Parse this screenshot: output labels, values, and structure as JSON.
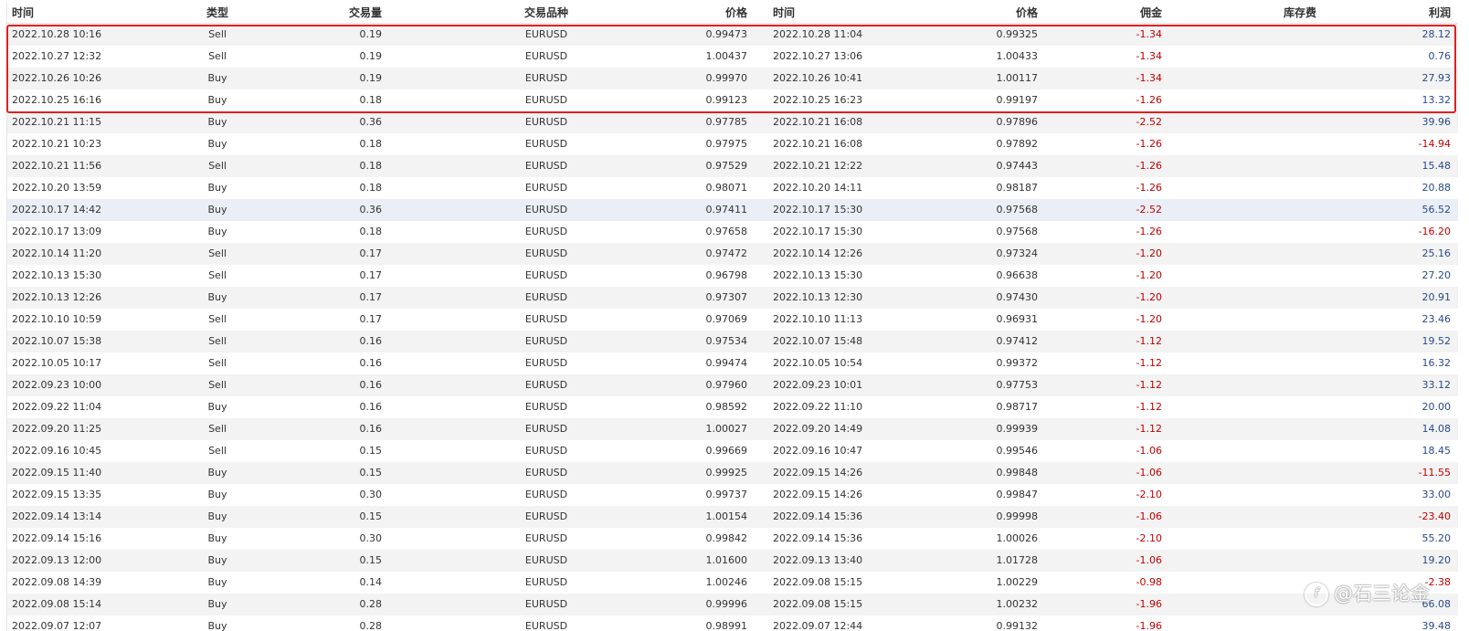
{
  "table": {
    "headers": {
      "open_time": "时间",
      "type": "类型",
      "volume": "交易量",
      "symbol": "交易品种",
      "open_price": "价格",
      "close_time": "时间",
      "close_price": "价格",
      "commission": "佣金",
      "swap": "库存费",
      "profit": "利润"
    },
    "rows": [
      {
        "open_time": "2022.10.28 10:16",
        "type": "Sell",
        "volume": "0.19",
        "symbol": "EURUSD",
        "open_price": "0.99473",
        "close_time": "2022.10.28 11:04",
        "close_price": "0.99325",
        "commission": "-1.34",
        "swap": "",
        "profit": "28.12"
      },
      {
        "open_time": "2022.10.27 12:32",
        "type": "Sell",
        "volume": "0.19",
        "symbol": "EURUSD",
        "open_price": "1.00437",
        "close_time": "2022.10.27 13:06",
        "close_price": "1.00433",
        "commission": "-1.34",
        "swap": "",
        "profit": "0.76"
      },
      {
        "open_time": "2022.10.26 10:26",
        "type": "Buy",
        "volume": "0.19",
        "symbol": "EURUSD",
        "open_price": "0.99970",
        "close_time": "2022.10.26 10:41",
        "close_price": "1.00117",
        "commission": "-1.34",
        "swap": "",
        "profit": "27.93"
      },
      {
        "open_time": "2022.10.25 16:16",
        "type": "Buy",
        "volume": "0.18",
        "symbol": "EURUSD",
        "open_price": "0.99123",
        "close_time": "2022.10.25 16:23",
        "close_price": "0.99197",
        "commission": "-1.26",
        "swap": "",
        "profit": "13.32"
      },
      {
        "open_time": "2022.10.21 11:15",
        "type": "Buy",
        "volume": "0.36",
        "symbol": "EURUSD",
        "open_price": "0.97785",
        "close_time": "2022.10.21 16:08",
        "close_price": "0.97896",
        "commission": "-2.52",
        "swap": "",
        "profit": "39.96"
      },
      {
        "open_time": "2022.10.21 10:23",
        "type": "Buy",
        "volume": "0.18",
        "symbol": "EURUSD",
        "open_price": "0.97975",
        "close_time": "2022.10.21 16:08",
        "close_price": "0.97892",
        "commission": "-1.26",
        "swap": "",
        "profit": "-14.94"
      },
      {
        "open_time": "2022.10.21 11:56",
        "type": "Sell",
        "volume": "0.18",
        "symbol": "EURUSD",
        "open_price": "0.97529",
        "close_time": "2022.10.21 12:22",
        "close_price": "0.97443",
        "commission": "-1.26",
        "swap": "",
        "profit": "15.48"
      },
      {
        "open_time": "2022.10.20 13:59",
        "type": "Buy",
        "volume": "0.18",
        "symbol": "EURUSD",
        "open_price": "0.98071",
        "close_time": "2022.10.20 14:11",
        "close_price": "0.98187",
        "commission": "-1.26",
        "swap": "",
        "profit": "20.88"
      },
      {
        "open_time": "2022.10.17 14:42",
        "type": "Buy",
        "volume": "0.36",
        "symbol": "EURUSD",
        "open_price": "0.97411",
        "close_time": "2022.10.17 15:30",
        "close_price": "0.97568",
        "commission": "-2.52",
        "swap": "",
        "profit": "56.52"
      },
      {
        "open_time": "2022.10.17 13:09",
        "type": "Buy",
        "volume": "0.18",
        "symbol": "EURUSD",
        "open_price": "0.97658",
        "close_time": "2022.10.17 15:30",
        "close_price": "0.97568",
        "commission": "-1.26",
        "swap": "",
        "profit": "-16.20"
      },
      {
        "open_time": "2022.10.14 11:20",
        "type": "Sell",
        "volume": "0.17",
        "symbol": "EURUSD",
        "open_price": "0.97472",
        "close_time": "2022.10.14 12:26",
        "close_price": "0.97324",
        "commission": "-1.20",
        "swap": "",
        "profit": "25.16"
      },
      {
        "open_time": "2022.10.13 15:30",
        "type": "Sell",
        "volume": "0.17",
        "symbol": "EURUSD",
        "open_price": "0.96798",
        "close_time": "2022.10.13 15:30",
        "close_price": "0.96638",
        "commission": "-1.20",
        "swap": "",
        "profit": "27.20"
      },
      {
        "open_time": "2022.10.13 12:26",
        "type": "Buy",
        "volume": "0.17",
        "symbol": "EURUSD",
        "open_price": "0.97307",
        "close_time": "2022.10.13 12:30",
        "close_price": "0.97430",
        "commission": "-1.20",
        "swap": "",
        "profit": "20.91"
      },
      {
        "open_time": "2022.10.10 10:59",
        "type": "Sell",
        "volume": "0.17",
        "symbol": "EURUSD",
        "open_price": "0.97069",
        "close_time": "2022.10.10 11:13",
        "close_price": "0.96931",
        "commission": "-1.20",
        "swap": "",
        "profit": "23.46"
      },
      {
        "open_time": "2022.10.07 15:38",
        "type": "Sell",
        "volume": "0.16",
        "symbol": "EURUSD",
        "open_price": "0.97534",
        "close_time": "2022.10.07 15:48",
        "close_price": "0.97412",
        "commission": "-1.12",
        "swap": "",
        "profit": "19.52"
      },
      {
        "open_time": "2022.10.05 10:17",
        "type": "Sell",
        "volume": "0.16",
        "symbol": "EURUSD",
        "open_price": "0.99474",
        "close_time": "2022.10.05 10:54",
        "close_price": "0.99372",
        "commission": "-1.12",
        "swap": "",
        "profit": "16.32"
      },
      {
        "open_time": "2022.09.23 10:00",
        "type": "Sell",
        "volume": "0.16",
        "symbol": "EURUSD",
        "open_price": "0.97960",
        "close_time": "2022.09.23 10:01",
        "close_price": "0.97753",
        "commission": "-1.12",
        "swap": "",
        "profit": "33.12"
      },
      {
        "open_time": "2022.09.22 11:04",
        "type": "Buy",
        "volume": "0.16",
        "symbol": "EURUSD",
        "open_price": "0.98592",
        "close_time": "2022.09.22 11:10",
        "close_price": "0.98717",
        "commission": "-1.12",
        "swap": "",
        "profit": "20.00"
      },
      {
        "open_time": "2022.09.20 11:25",
        "type": "Sell",
        "volume": "0.16",
        "symbol": "EURUSD",
        "open_price": "1.00027",
        "close_time": "2022.09.20 14:49",
        "close_price": "0.99939",
        "commission": "-1.12",
        "swap": "",
        "profit": "14.08"
      },
      {
        "open_time": "2022.09.16 10:45",
        "type": "Sell",
        "volume": "0.15",
        "symbol": "EURUSD",
        "open_price": "0.99669",
        "close_time": "2022.09.16 10:47",
        "close_price": "0.99546",
        "commission": "-1.06",
        "swap": "",
        "profit": "18.45"
      },
      {
        "open_time": "2022.09.15 11:40",
        "type": "Buy",
        "volume": "0.15",
        "symbol": "EURUSD",
        "open_price": "0.99925",
        "close_time": "2022.09.15 14:26",
        "close_price": "0.99848",
        "commission": "-1.06",
        "swap": "",
        "profit": "-11.55"
      },
      {
        "open_time": "2022.09.15 13:35",
        "type": "Buy",
        "volume": "0.30",
        "symbol": "EURUSD",
        "open_price": "0.99737",
        "close_time": "2022.09.15 14:26",
        "close_price": "0.99847",
        "commission": "-2.10",
        "swap": "",
        "profit": "33.00"
      },
      {
        "open_time": "2022.09.14 13:14",
        "type": "Buy",
        "volume": "0.15",
        "symbol": "EURUSD",
        "open_price": "1.00154",
        "close_time": "2022.09.14 15:36",
        "close_price": "0.99998",
        "commission": "-1.06",
        "swap": "",
        "profit": "-23.40"
      },
      {
        "open_time": "2022.09.14 15:16",
        "type": "Buy",
        "volume": "0.30",
        "symbol": "EURUSD",
        "open_price": "0.99842",
        "close_time": "2022.09.14 15:36",
        "close_price": "1.00026",
        "commission": "-2.10",
        "swap": "",
        "profit": "55.20"
      },
      {
        "open_time": "2022.09.13 12:00",
        "type": "Buy",
        "volume": "0.15",
        "symbol": "EURUSD",
        "open_price": "1.01600",
        "close_time": "2022.09.13 13:40",
        "close_price": "1.01728",
        "commission": "-1.06",
        "swap": "",
        "profit": "19.20"
      },
      {
        "open_time": "2022.09.08 14:39",
        "type": "Buy",
        "volume": "0.14",
        "symbol": "EURUSD",
        "open_price": "1.00246",
        "close_time": "2022.09.08 15:15",
        "close_price": "1.00229",
        "commission": "-0.98",
        "swap": "",
        "profit": "-2.38"
      },
      {
        "open_time": "2022.09.08 15:14",
        "type": "Buy",
        "volume": "0.28",
        "symbol": "EURUSD",
        "open_price": "0.99996",
        "close_time": "2022.09.08 15:15",
        "close_price": "1.00232",
        "commission": "-1.96",
        "swap": "",
        "profit": "66.08"
      },
      {
        "open_time": "2022.09.07 12:07",
        "type": "Buy",
        "volume": "0.28",
        "symbol": "EURUSD",
        "open_price": "0.98991",
        "close_time": "2022.09.07 12:44",
        "close_price": "0.99132",
        "commission": "-1.96",
        "swap": "",
        "profit": "39.48"
      }
    ]
  },
  "watermark": {
    "logo_glyph": "f",
    "text": "@石三论金"
  },
  "colors": {
    "negative": "#c00000",
    "positive": "#2a4a8c",
    "highlight_box": "#e02020"
  }
}
